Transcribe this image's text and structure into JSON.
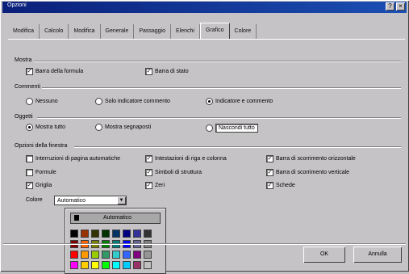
{
  "window": {
    "title": "Opzioni",
    "btn_help": "?",
    "btn_close": "×"
  },
  "tabs": [
    "Modifica",
    "Calcolo",
    "Modifica",
    "Generale",
    "Passaggio",
    "Elenchi",
    "Grafico",
    "Colore"
  ],
  "active_tab": 6,
  "groups": {
    "mostra": {
      "title": "Mostra",
      "items": [
        {
          "label": "Barra della formula",
          "checked": true
        },
        {
          "label": "Barra di stato",
          "checked": true
        }
      ]
    },
    "commenti": {
      "title": "Commenti",
      "items": [
        {
          "label": "Nessuno",
          "selected": false
        },
        {
          "label": "Solo indicatore commento",
          "selected": false
        },
        {
          "label": "Indicatore e commento",
          "selected": true
        }
      ]
    },
    "oggetti": {
      "title": "Oggetti",
      "items": [
        {
          "label": "Mostra tutto",
          "selected": true
        },
        {
          "label": "Mostra segnaposti",
          "selected": false
        },
        {
          "label": "Nascondi tutto",
          "selected": false
        }
      ]
    },
    "opzioni_finestra": {
      "title": "Opzioni della finestra",
      "col1": [
        {
          "label": "Interruzioni di pagina automatiche",
          "checked": false
        },
        {
          "label": "Formule",
          "checked": false
        },
        {
          "label": "Griglia",
          "checked": true
        }
      ],
      "col2": [
        {
          "label": "Intestazioni di riga e colonna",
          "checked": true
        },
        {
          "label": "Simboli di struttura",
          "checked": true
        },
        {
          "label": "Zeri",
          "checked": true
        }
      ],
      "col3": [
        {
          "label": "Barra di scorrimento orizzontale",
          "checked": true
        },
        {
          "label": "Barra di scorrimento verticale",
          "checked": true
        },
        {
          "label": "Schede",
          "checked": true
        }
      ],
      "color_label": "Colore",
      "color_value": "Automatico"
    }
  },
  "palette": {
    "auto_label": "Automatico",
    "colors": [
      "#000000",
      "#993300",
      "#333300",
      "#003300",
      "#003366",
      "#000080",
      "#333399",
      "#333333",
      "#800000",
      "#ff6600",
      "#808000",
      "#008000",
      "#008080",
      "#0000ff",
      "#666699",
      "#808080",
      "#ff0000",
      "#ff9900",
      "#99cc00",
      "#339966",
      "#33cccc",
      "#3366ff",
      "#800080",
      "#969696",
      "#ff00ff",
      "#ffcc00",
      "#ffff00",
      "#00ff00",
      "#00ffff",
      "#00ccff",
      "#993366",
      "#c0c0c0"
    ]
  },
  "buttons": {
    "ok": "OK",
    "cancel": "Annulla"
  }
}
